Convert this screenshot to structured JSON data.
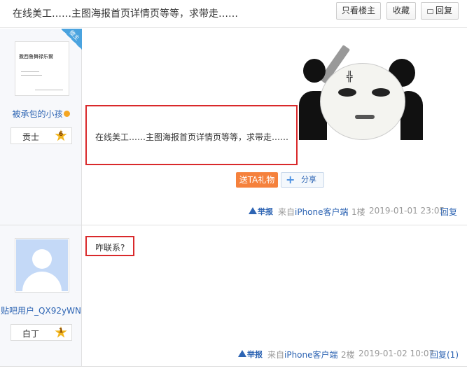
{
  "thread": {
    "title": "在线美工……主图海报首页详情页等等，求带走……",
    "buttons": {
      "only_op": "只看楼主",
      "favorite": "收藏",
      "reply": "回复"
    }
  },
  "posts": [
    {
      "op_badge": "楼主",
      "username": "被承包的小孩",
      "level_name": "贡士",
      "level_num": "6",
      "avatar_text": "撒西鲁舞禄乐爾",
      "content": "在线美工……主图海报首页详情页等等，求带走……",
      "gift_label": "送TA礼物",
      "share_label": "分享",
      "report": "举报",
      "from": "来自",
      "client": "iPhone客户端",
      "floor": "1楼",
      "time": "2019-01-01 23:05",
      "reply": "回复"
    },
    {
      "username": "贴吧用户_QX92yWN",
      "level_name": "白丁",
      "level_num": "1",
      "content": "咋联系?",
      "report": "举报",
      "from": "来自",
      "client": "iPhone客户端",
      "floor": "2楼",
      "time": "2019-01-02 10:07",
      "reply": "回复(1)"
    }
  ],
  "colors": {
    "link": "#2d64b3",
    "highlight_border": "#d9292b",
    "gift": "#f5813c",
    "star": "#f2b51d"
  },
  "icons": [
    "reply-icon",
    "smile-icon",
    "level-star-icon",
    "warning-icon",
    "plus-icon"
  ]
}
